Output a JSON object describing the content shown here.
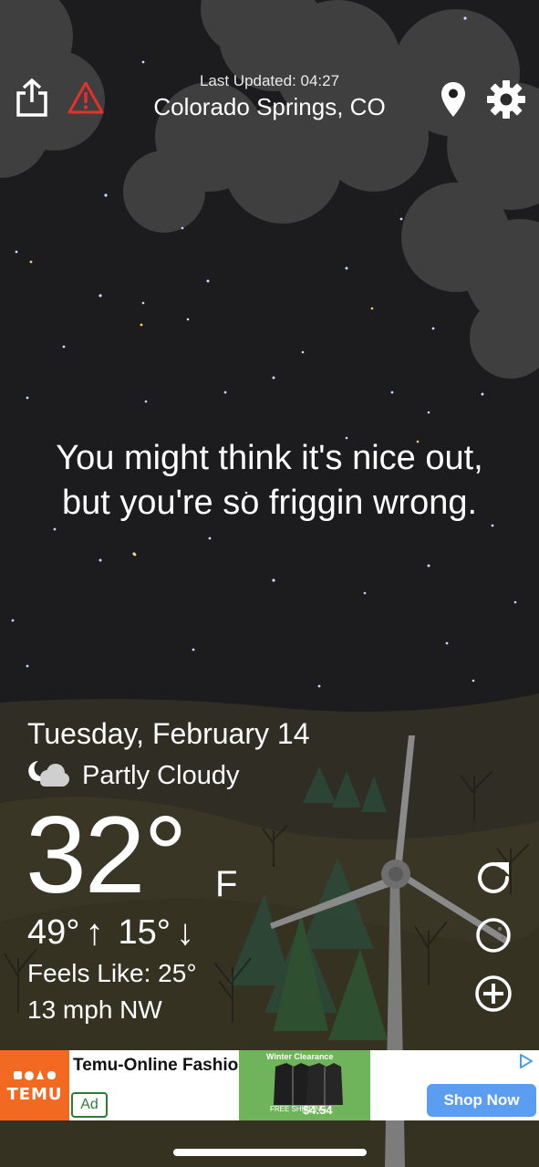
{
  "header": {
    "last_updated": "Last Updated: 04:27",
    "location": "Colorado Springs, CO"
  },
  "icons": {
    "share": "share-icon",
    "alert": "warning-icon",
    "location": "location-pin-icon",
    "settings": "gear-icon",
    "refresh": "refresh-icon",
    "moon": "moon-phase-icon",
    "add": "add-icon",
    "condition": "partly-cloudy-night-icon"
  },
  "quote": {
    "line1": "You might think it's nice out,",
    "line2": "but you're so friggin wrong."
  },
  "weather": {
    "date": "Tuesday, February 14",
    "condition": "Partly Cloudy",
    "temp": "32°",
    "unit": "F",
    "high": "49°",
    "low": "15°",
    "feels_like": "Feels Like: 25°",
    "wind": "13 mph NW"
  },
  "ad": {
    "brand": "TEMU",
    "title": "Temu-Online Fashion",
    "badge": "Ad",
    "promo": "Winter Clearance",
    "free": "FREE SHIPPING",
    "price": "$4.54",
    "cta": "Shop Now"
  },
  "colors": {
    "sky": "#1c1c1e",
    "ground": "#3a3626",
    "alert_red": "#e5312b",
    "temu_orange": "#f26a21",
    "cta_blue": "#5b9df0"
  }
}
